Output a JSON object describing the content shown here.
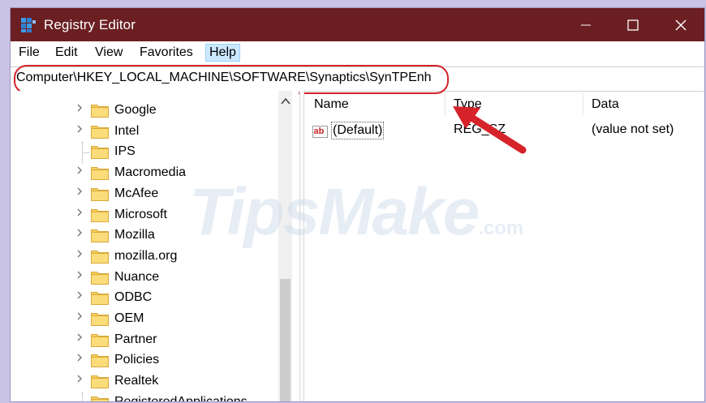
{
  "window": {
    "title": "Registry Editor"
  },
  "menu": {
    "items": [
      "File",
      "Edit",
      "View",
      "Favorites",
      "Help"
    ],
    "active": "Help"
  },
  "address": {
    "path": "Computer\\HKEY_LOCAL_MACHINE\\SOFTWARE\\Synaptics\\SynTPEnh"
  },
  "tree": {
    "items": [
      {
        "label": "Google",
        "expandable": true
      },
      {
        "label": "Intel",
        "expandable": true
      },
      {
        "label": "IPS",
        "expandable": false
      },
      {
        "label": "Macromedia",
        "expandable": true
      },
      {
        "label": "McAfee",
        "expandable": true
      },
      {
        "label": "Microsoft",
        "expandable": true
      },
      {
        "label": "Mozilla",
        "expandable": true
      },
      {
        "label": "mozilla.org",
        "expandable": true
      },
      {
        "label": "Nuance",
        "expandable": true
      },
      {
        "label": "ODBC",
        "expandable": true
      },
      {
        "label": "OEM",
        "expandable": true
      },
      {
        "label": "Partner",
        "expandable": true
      },
      {
        "label": "Policies",
        "expandable": true
      },
      {
        "label": "Realtek",
        "expandable": true
      },
      {
        "label": "RegisteredApplications",
        "expandable": false
      }
    ]
  },
  "columns": {
    "name": "Name",
    "type": "Type",
    "data": "Data"
  },
  "values": [
    {
      "name": "(Default)",
      "type": "REG_SZ",
      "data": "(value not set)"
    }
  ],
  "watermark": {
    "brand": "TipsMake",
    "suffix": ".com"
  },
  "colors": {
    "titlebar": "#6b1f22",
    "highlight": "#d6232a",
    "folder": "#f5cf5a"
  },
  "icons": {
    "app": "registry-editor-icon",
    "value": "ab-string-icon",
    "folder": "folder-icon",
    "annotation": "red-arrow"
  }
}
